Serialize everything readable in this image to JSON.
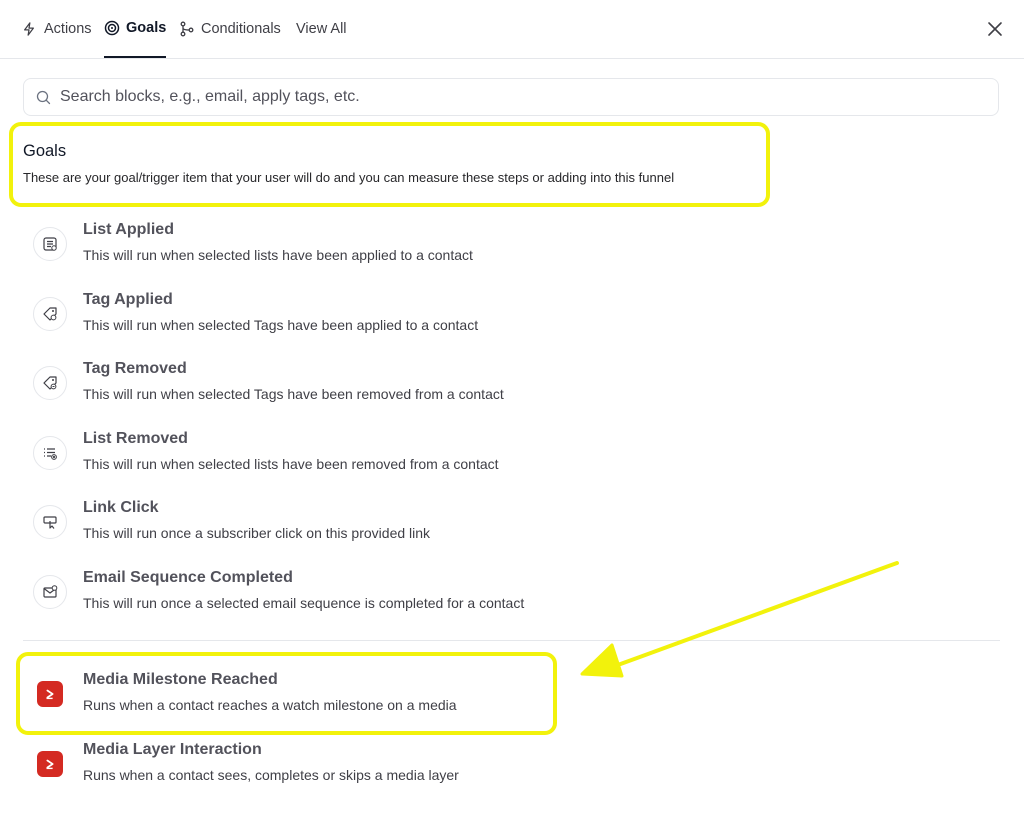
{
  "tabs": [
    {
      "label": "Actions",
      "icon": "bolt-icon"
    },
    {
      "label": "Goals",
      "icon": "target-icon",
      "active": true
    },
    {
      "label": "Conditionals",
      "icon": "branch-icon"
    },
    {
      "label": "View All"
    }
  ],
  "search": {
    "placeholder": "Search blocks, e.g., email, apply tags, etc.",
    "value": ""
  },
  "section": {
    "title": "Goals",
    "description": "These are your goal/trigger item that your user will do and you can measure these steps or adding into this funnel"
  },
  "goals": [
    {
      "title": "List Applied",
      "description": "This will run when selected lists have been applied to a contact",
      "icon": "list-applied-icon"
    },
    {
      "title": "Tag Applied",
      "description": "This will run when selected Tags have been applied to a contact",
      "icon": "tag-applied-icon"
    },
    {
      "title": "Tag Removed",
      "description": "This will run when selected Tags have been removed from a contact",
      "icon": "tag-removed-icon"
    },
    {
      "title": "List Removed",
      "description": "This will run when selected lists have been removed from a contact",
      "icon": "list-removed-icon"
    },
    {
      "title": "Link Click",
      "description": "This will run once a subscriber click on this provided link",
      "icon": "link-click-icon"
    },
    {
      "title": "Email Sequence Completed",
      "description": "This will run once a selected email sequence is completed for a contact",
      "icon": "email-sequence-icon"
    }
  ],
  "media_goals": [
    {
      "title": "Media Milestone Reached",
      "description": "Runs when a contact reaches a watch milestone on a media",
      "icon": "media-play-icon"
    },
    {
      "title": "Media Layer Interaction",
      "description": "Runs when a contact sees, completes or skips a media layer",
      "icon": "media-play-icon"
    }
  ],
  "colors": {
    "highlight": "#f2f20c",
    "media_brand": "#d42a22"
  }
}
